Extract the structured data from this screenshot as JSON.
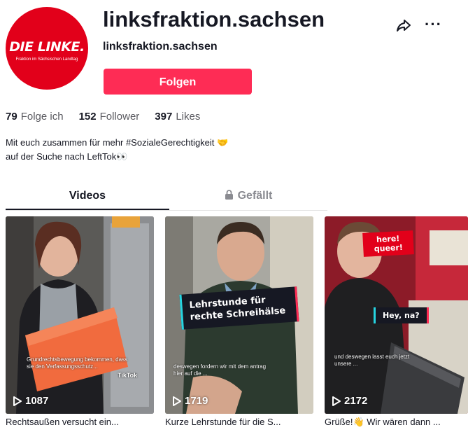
{
  "profile": {
    "username": "linksfraktion.sachsen",
    "nickname": "linksfraktion.sachsen",
    "avatar_logo": "DIE LINKE.",
    "avatar_sub": "Fraktion im Sächsischen Landtag",
    "follow_label": "Folgen",
    "bio_line1": "Mit euch zusammen für mehr #SozialeGerechtigkeit 🤝",
    "bio_line2": "auf der Suche nach LeftTok👀"
  },
  "stats": [
    {
      "count": "79",
      "label": "Folge ich"
    },
    {
      "count": "152",
      "label": "Follower"
    },
    {
      "count": "397",
      "label": "Likes"
    }
  ],
  "tabs": {
    "videos": "Videos",
    "liked": "Gefällt"
  },
  "videos": [
    {
      "views": "1087",
      "caption": "Rechtsaußen versucht ein...",
      "overlay": "Grundrechtsbewegung bekommen, dass sie den Verfassungsschutz...",
      "watermark": "TikTok"
    },
    {
      "views": "1719",
      "caption": "Kurze Lehrstunde für die S...",
      "sticker": "Lehrstunde für rechte Schreihälse",
      "overlay": "deswegen fordern wir mit dem antrag hier auf die ..."
    },
    {
      "views": "2172",
      "caption": "Grüße!👋 Wir wären dann ...",
      "sticker": "Hey, na?",
      "overlay": "und deswegen lasst euch jetzt unsere ...",
      "sign": "here! queer!"
    }
  ],
  "colors": {
    "accent": "#fe2c55",
    "brand_red": "#e2001a",
    "text": "#161823",
    "muted": "#8a8b91"
  }
}
